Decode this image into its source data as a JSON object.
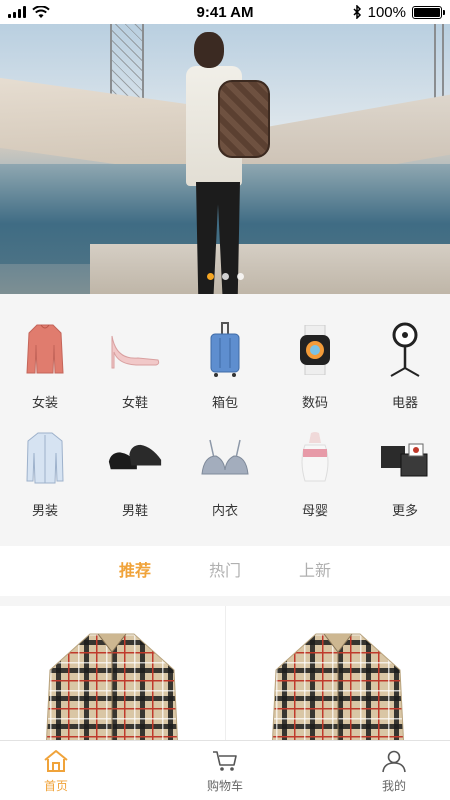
{
  "status_bar": {
    "time": "9:41 AM",
    "battery": "100%",
    "icons": [
      "signal-icon",
      "wifi-icon",
      "bluetooth-icon",
      "battery-icon"
    ]
  },
  "banner": {
    "slides_count": 3,
    "active_slide": 1
  },
  "categories": [
    {
      "label": "女装",
      "icon": "women-clothing-icon"
    },
    {
      "label": "女鞋",
      "icon": "women-shoes-icon"
    },
    {
      "label": "箱包",
      "icon": "luggage-icon"
    },
    {
      "label": "数码",
      "icon": "digital-watch-icon"
    },
    {
      "label": "电器",
      "icon": "appliance-fan-icon"
    },
    {
      "label": "男装",
      "icon": "men-shirt-icon"
    },
    {
      "label": "男鞋",
      "icon": "men-shoes-icon"
    },
    {
      "label": "内衣",
      "icon": "underwear-icon"
    },
    {
      "label": "母婴",
      "icon": "baby-bottle-icon"
    },
    {
      "label": "更多",
      "icon": "more-icon"
    }
  ],
  "tabs": [
    {
      "label": "推荐",
      "active": true
    },
    {
      "label": "热门",
      "active": false
    },
    {
      "label": "上新",
      "active": false
    }
  ],
  "bottom_nav": [
    {
      "label": "首页",
      "icon": "home-icon",
      "active": true
    },
    {
      "label": "购物车",
      "icon": "cart-icon",
      "active": false
    },
    {
      "label": "我的",
      "icon": "user-icon",
      "active": false
    }
  ],
  "colors": {
    "accent": "#f0a33a",
    "inactive_text": "#b0b0b0",
    "background": "#f5f5f5"
  }
}
